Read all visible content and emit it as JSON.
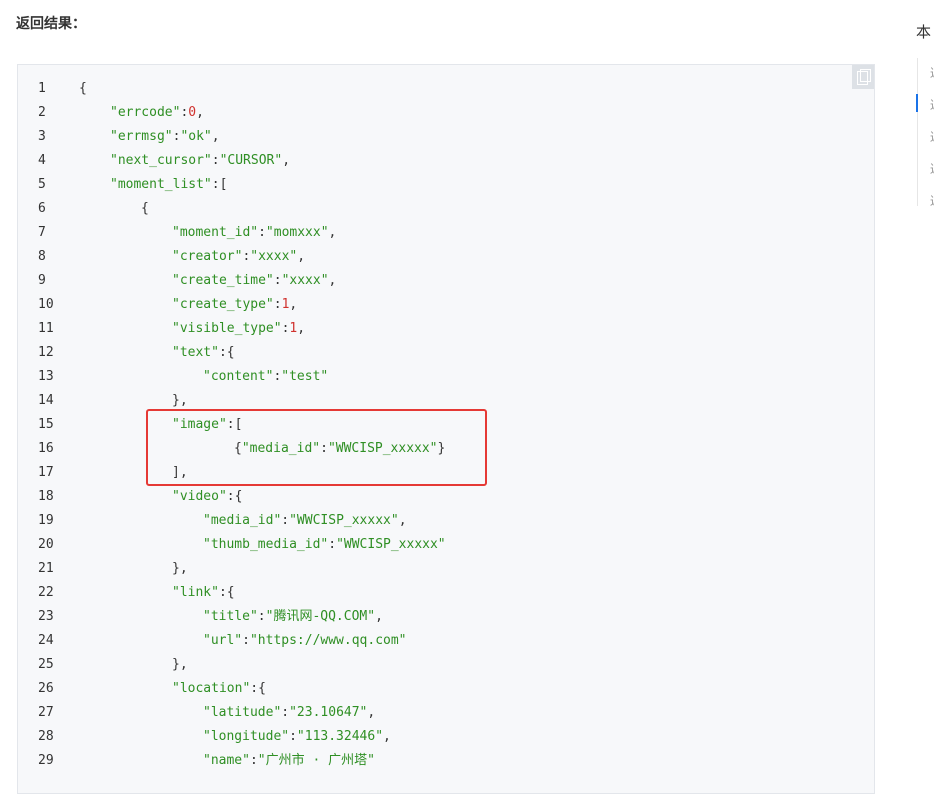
{
  "section_heading": "返回结果：",
  "toc": {
    "title": "本",
    "items": [
      "返回",
      "返回",
      "返回",
      "返回",
      "返回"
    ]
  },
  "colors": {
    "key": "#2f8f24",
    "string": "#2f8f24",
    "number": "#d0312d",
    "punct": "#333333",
    "highlight_border": "#e53935"
  },
  "code_lines": [
    {
      "num": "1",
      "indent": 0,
      "tokens": [
        {
          "t": "{",
          "c": "p"
        }
      ]
    },
    {
      "num": "2",
      "indent": 1,
      "tokens": [
        {
          "t": "\"errcode\"",
          "c": "k"
        },
        {
          "t": ":",
          "c": "p"
        },
        {
          "t": "0",
          "c": "n"
        },
        {
          "t": ",",
          "c": "p"
        }
      ]
    },
    {
      "num": "3",
      "indent": 1,
      "tokens": [
        {
          "t": "\"errmsg\"",
          "c": "k"
        },
        {
          "t": ":",
          "c": "p"
        },
        {
          "t": "\"ok\"",
          "c": "s"
        },
        {
          "t": ",",
          "c": "p"
        }
      ]
    },
    {
      "num": "4",
      "indent": 1,
      "tokens": [
        {
          "t": "\"next_cursor\"",
          "c": "k"
        },
        {
          "t": ":",
          "c": "p"
        },
        {
          "t": "\"CURSOR\"",
          "c": "s"
        },
        {
          "t": ",",
          "c": "p"
        }
      ]
    },
    {
      "num": "5",
      "indent": 1,
      "tokens": [
        {
          "t": "\"moment_list\"",
          "c": "k"
        },
        {
          "t": ":[",
          "c": "p"
        }
      ]
    },
    {
      "num": "6",
      "indent": 2,
      "tokens": [
        {
          "t": "{",
          "c": "p"
        }
      ]
    },
    {
      "num": "7",
      "indent": 3,
      "tokens": [
        {
          "t": "\"moment_id\"",
          "c": "k"
        },
        {
          "t": ":",
          "c": "p"
        },
        {
          "t": "\"momxxx\"",
          "c": "s"
        },
        {
          "t": ",",
          "c": "p"
        }
      ]
    },
    {
      "num": "8",
      "indent": 3,
      "tokens": [
        {
          "t": "\"creator\"",
          "c": "k"
        },
        {
          "t": ":",
          "c": "p"
        },
        {
          "t": "\"xxxx\"",
          "c": "s"
        },
        {
          "t": ",",
          "c": "p"
        }
      ]
    },
    {
      "num": "9",
      "indent": 3,
      "tokens": [
        {
          "t": "\"create_time\"",
          "c": "k"
        },
        {
          "t": ":",
          "c": "p"
        },
        {
          "t": "\"xxxx\"",
          "c": "s"
        },
        {
          "t": ",",
          "c": "p"
        }
      ]
    },
    {
      "num": "10",
      "indent": 3,
      "tokens": [
        {
          "t": "\"create_type\"",
          "c": "k"
        },
        {
          "t": ":",
          "c": "p"
        },
        {
          "t": "1",
          "c": "n"
        },
        {
          "t": ",",
          "c": "p"
        }
      ]
    },
    {
      "num": "11",
      "indent": 3,
      "tokens": [
        {
          "t": "\"visible_type\"",
          "c": "k"
        },
        {
          "t": ":",
          "c": "p"
        },
        {
          "t": "1",
          "c": "n"
        },
        {
          "t": ",",
          "c": "p"
        }
      ]
    },
    {
      "num": "12",
      "indent": 3,
      "tokens": [
        {
          "t": "\"text\"",
          "c": "k"
        },
        {
          "t": ":{",
          "c": "p"
        }
      ]
    },
    {
      "num": "13",
      "indent": 4,
      "tokens": [
        {
          "t": "\"content\"",
          "c": "k"
        },
        {
          "t": ":",
          "c": "p"
        },
        {
          "t": "\"test\"",
          "c": "s"
        }
      ]
    },
    {
      "num": "14",
      "indent": 3,
      "tokens": [
        {
          "t": "},",
          "c": "p"
        }
      ]
    },
    {
      "num": "15",
      "indent": 3,
      "tokens": [
        {
          "t": "\"image\"",
          "c": "k"
        },
        {
          "t": ":[",
          "c": "p"
        }
      ]
    },
    {
      "num": "16",
      "indent": 5,
      "tokens": [
        {
          "t": "{",
          "c": "p"
        },
        {
          "t": "\"media_id\"",
          "c": "k"
        },
        {
          "t": ":",
          "c": "p"
        },
        {
          "t": "\"WWCISP_xxxxx\"",
          "c": "s"
        },
        {
          "t": "}",
          "c": "p"
        }
      ]
    },
    {
      "num": "17",
      "indent": 3,
      "tokens": [
        {
          "t": "],",
          "c": "p"
        }
      ]
    },
    {
      "num": "18",
      "indent": 3,
      "tokens": [
        {
          "t": "\"video\"",
          "c": "k"
        },
        {
          "t": ":{",
          "c": "p"
        }
      ]
    },
    {
      "num": "19",
      "indent": 4,
      "tokens": [
        {
          "t": "\"media_id\"",
          "c": "k"
        },
        {
          "t": ":",
          "c": "p"
        },
        {
          "t": "\"WWCISP_xxxxx\"",
          "c": "s"
        },
        {
          "t": ",",
          "c": "p"
        }
      ]
    },
    {
      "num": "20",
      "indent": 4,
      "tokens": [
        {
          "t": "\"thumb_media_id\"",
          "c": "k"
        },
        {
          "t": ":",
          "c": "p"
        },
        {
          "t": "\"WWCISP_xxxxx\"",
          "c": "s"
        }
      ]
    },
    {
      "num": "21",
      "indent": 3,
      "tokens": [
        {
          "t": "},",
          "c": "p"
        }
      ]
    },
    {
      "num": "22",
      "indent": 3,
      "tokens": [
        {
          "t": "\"link\"",
          "c": "k"
        },
        {
          "t": ":{",
          "c": "p"
        }
      ]
    },
    {
      "num": "23",
      "indent": 4,
      "tokens": [
        {
          "t": "\"title\"",
          "c": "k"
        },
        {
          "t": ":",
          "c": "p"
        },
        {
          "t": "\"腾讯网-QQ.COM\"",
          "c": "s"
        },
        {
          "t": ",",
          "c": "p"
        }
      ]
    },
    {
      "num": "24",
      "indent": 4,
      "tokens": [
        {
          "t": "\"url\"",
          "c": "k"
        },
        {
          "t": ":",
          "c": "p"
        },
        {
          "t": "\"https://www.qq.com\"",
          "c": "s"
        }
      ]
    },
    {
      "num": "25",
      "indent": 3,
      "tokens": [
        {
          "t": "},",
          "c": "p"
        }
      ]
    },
    {
      "num": "26",
      "indent": 3,
      "tokens": [
        {
          "t": "\"location\"",
          "c": "k"
        },
        {
          "t": ":{",
          "c": "p"
        }
      ]
    },
    {
      "num": "27",
      "indent": 4,
      "tokens": [
        {
          "t": "\"latitude\"",
          "c": "k"
        },
        {
          "t": ":",
          "c": "p"
        },
        {
          "t": "\"23.10647\"",
          "c": "s"
        },
        {
          "t": ",",
          "c": "p"
        }
      ]
    },
    {
      "num": "28",
      "indent": 4,
      "tokens": [
        {
          "t": "\"longitude\"",
          "c": "k"
        },
        {
          "t": ":",
          "c": "p"
        },
        {
          "t": "\"113.32446\"",
          "c": "s"
        },
        {
          "t": ",",
          "c": "p"
        }
      ]
    },
    {
      "num": "29",
      "indent": 4,
      "tokens": [
        {
          "t": "\"name\"",
          "c": "k"
        },
        {
          "t": ":",
          "c": "p"
        },
        {
          "t": "\"广州市 · 广州塔\"",
          "c": "s"
        }
      ]
    }
  ]
}
